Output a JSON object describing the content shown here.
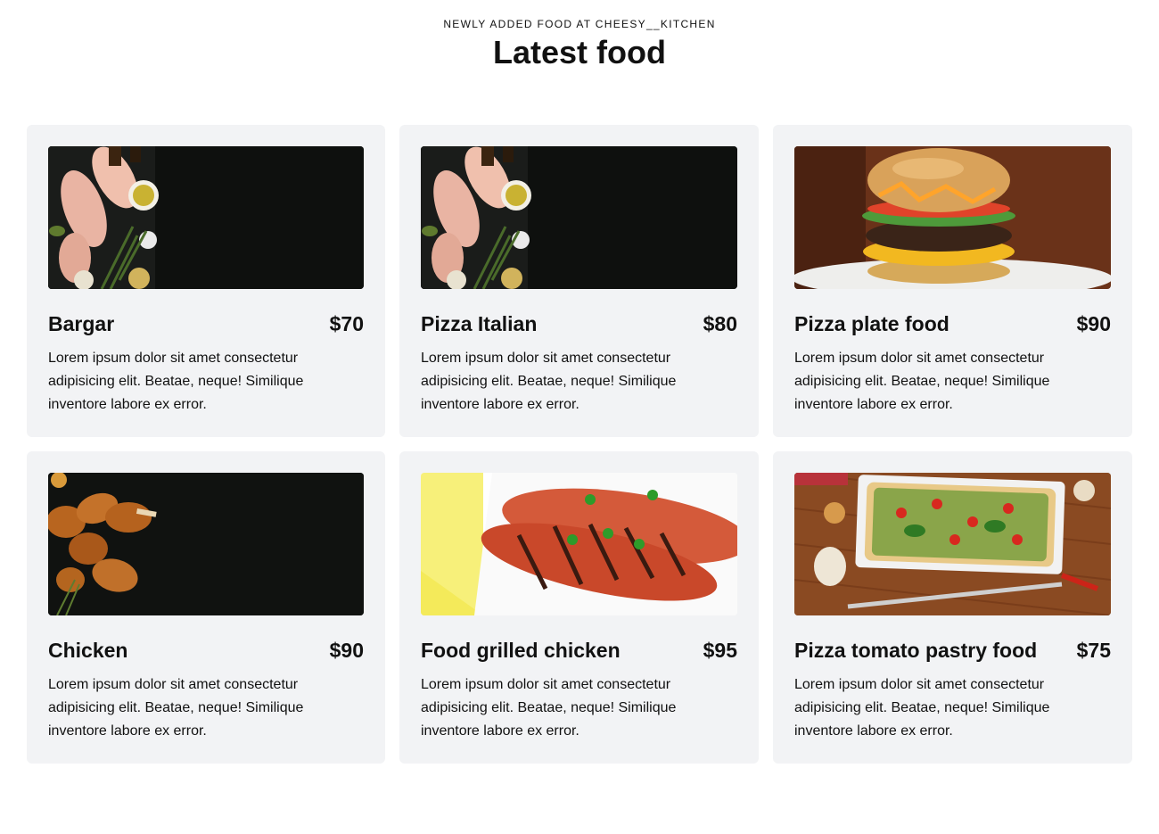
{
  "header": {
    "eyebrow": "NEWLY ADDED FOOD AT CHEESY__KITCHEN",
    "title": "Latest food"
  },
  "cards": [
    {
      "name": "Bargar",
      "price": "$70",
      "description": "Lorem ipsum dolor sit amet consectetur adipisicing elit. Beatae, neque! Similique inventore labore ex error.",
      "image": "raw-chicken-spices-photo"
    },
    {
      "name": "Pizza Italian",
      "price": "$80",
      "description": "Lorem ipsum dolor sit amet consectetur adipisicing elit. Beatae, neque! Similique inventore labore ex error.",
      "image": "raw-chicken-spices-photo"
    },
    {
      "name": "Pizza plate food",
      "price": "$90",
      "description": "Lorem ipsum dolor sit amet consectetur adipisicing elit. Beatae, neque! Similique inventore labore ex error.",
      "image": "cheeseburger-photo"
    },
    {
      "name": "Chicken",
      "price": "$90",
      "description": "Lorem ipsum dolor sit amet consectetur adipisicing elit. Beatae, neque! Similique inventore labore ex error.",
      "image": "fried-chicken-legs-photo"
    },
    {
      "name": "Food grilled chicken",
      "price": "$95",
      "description": "Lorem ipsum dolor sit amet consectetur adipisicing elit. Beatae, neque! Similique inventore labore ex error.",
      "image": "grilled-chicken-photo"
    },
    {
      "name": "Pizza tomato pastry food",
      "price": "$75",
      "description": "Lorem ipsum dolor sit amet consectetur adipisicing elit. Beatae, neque! Similique inventore labore ex error.",
      "image": "tomato-pizza-photo"
    }
  ],
  "colors": {
    "card_background": "#f2f3f5",
    "text": "#111111",
    "page_background": "#ffffff"
  }
}
